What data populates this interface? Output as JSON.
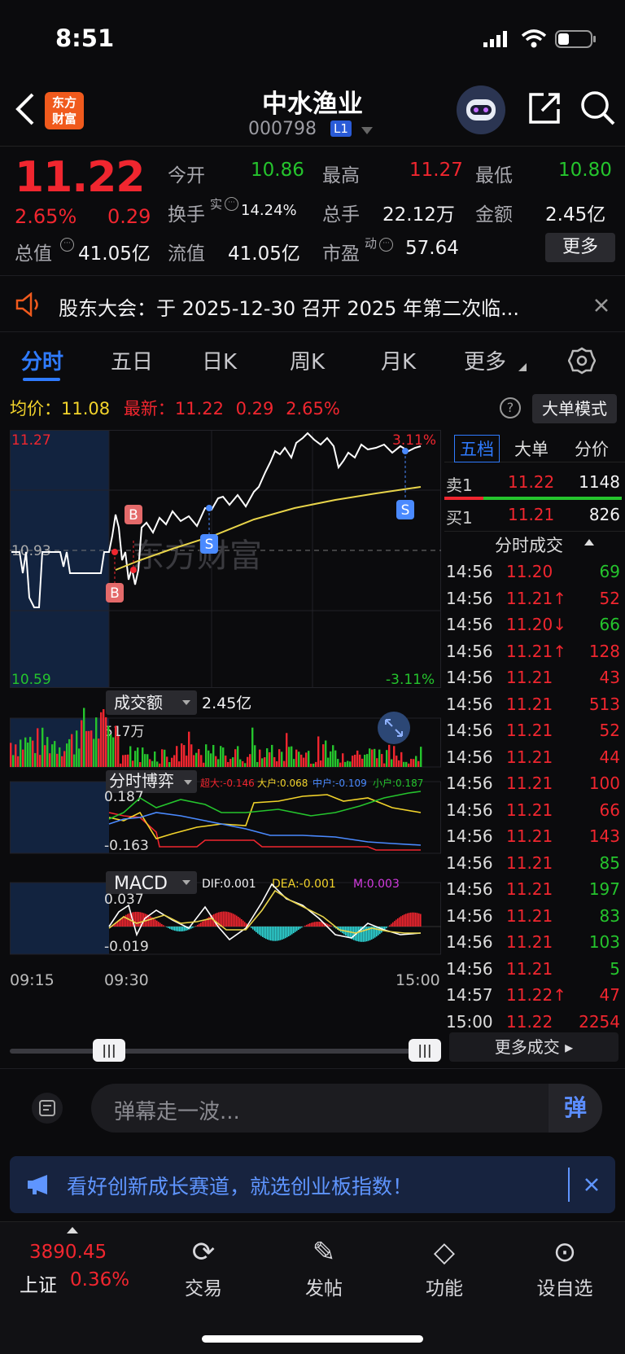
{
  "status": {
    "time": "8:51"
  },
  "header": {
    "logo_text_1": "东方",
    "logo_text_2": "财富",
    "stock_name": "中水渔业",
    "stock_code": "000798",
    "level": "L1"
  },
  "quote": {
    "last": "11.22",
    "change_pct": "2.65%",
    "change": "0.29",
    "open_label": "今开",
    "open": "10.86",
    "high_label": "最高",
    "high": "11.27",
    "low_label": "最低",
    "low": "10.80",
    "turnover_label": "换手",
    "turnover_sup": "实",
    "turnover": "14.24%",
    "volume_label": "总手",
    "volume": "22.12万",
    "amount_label": "金额",
    "amount": "2.45亿",
    "mktcap_label": "总值",
    "mktcap": "41.05亿",
    "float_label": "流值",
    "float": "41.05亿",
    "pe_label": "市盈",
    "pe_sup": "动",
    "pe": "57.64",
    "more_label": "更多"
  },
  "notice": {
    "text": "股东大会：于 2025-12-30 召开 2025 年第二次临..."
  },
  "tabs": [
    "分时",
    "五日",
    "日K",
    "周K",
    "月K",
    "更多"
  ],
  "info": {
    "avg_label": "均价：",
    "avg": "11.08",
    "latest_label": "最新：",
    "latest": "11.22",
    "chg": "0.29",
    "pct": "2.65%",
    "mode_btn": "大单模式"
  },
  "chart": {
    "price_top": "11.27",
    "price_bottom": "10.59",
    "price_mid": "10.93",
    "pct_top": "3.11%",
    "pct_bottom": "-3.11%",
    "watermark": "东方财富",
    "buy_marker": "B",
    "sell_marker": "S",
    "volume_title": "成交额",
    "volume_total": "2.45亿",
    "volume_max": "517万",
    "game_title": "分时博弈",
    "game_super": "超大:-0.146",
    "game_big": "大户:0.068",
    "game_mid": "中户:-0.109",
    "game_small": "小户:0.187",
    "game_top": "0.187",
    "game_bottom": "-0.163",
    "macd_title": "MACD",
    "dif": "DIF:0.001",
    "dea": "DEA:-0.001",
    "m": "M:0.003",
    "macd_top": "0.037",
    "macd_bottom": "-0.019",
    "time_start": "09:15",
    "time_open": "09:30",
    "time_end": "15:00",
    "colors": {
      "up": "#f0262f",
      "down": "#25c42d",
      "avg": "#e8d44a",
      "price": "#ffffff"
    }
  },
  "book": {
    "tabs": [
      "五档",
      "大单",
      "分价"
    ],
    "sell1_label": "卖1",
    "sell1_price": "11.22",
    "sell1_vol": "1148",
    "buy1_label": "买1",
    "buy1_price": "11.21",
    "buy1_vol": "826",
    "ticks_title": "分时成交",
    "ticks": [
      {
        "t": "14:56",
        "p": "11.20",
        "v": "69",
        "pc": "red",
        "vc": "green"
      },
      {
        "t": "14:56",
        "p": "11.21↑",
        "v": "52",
        "pc": "red",
        "vc": "red"
      },
      {
        "t": "14:56",
        "p": "11.20↓",
        "v": "66",
        "pc": "red",
        "vc": "green"
      },
      {
        "t": "14:56",
        "p": "11.21↑",
        "v": "128",
        "pc": "red",
        "vc": "red"
      },
      {
        "t": "14:56",
        "p": "11.21",
        "v": "43",
        "pc": "red",
        "vc": "red"
      },
      {
        "t": "14:56",
        "p": "11.21",
        "v": "513",
        "pc": "red",
        "vc": "red"
      },
      {
        "t": "14:56",
        "p": "11.21",
        "v": "52",
        "pc": "red",
        "vc": "red"
      },
      {
        "t": "14:56",
        "p": "11.21",
        "v": "44",
        "pc": "red",
        "vc": "red"
      },
      {
        "t": "14:56",
        "p": "11.21",
        "v": "100",
        "pc": "red",
        "vc": "red"
      },
      {
        "t": "14:56",
        "p": "11.21",
        "v": "66",
        "pc": "red",
        "vc": "red"
      },
      {
        "t": "14:56",
        "p": "11.21",
        "v": "143",
        "pc": "red",
        "vc": "red"
      },
      {
        "t": "14:56",
        "p": "11.21",
        "v": "85",
        "pc": "red",
        "vc": "green"
      },
      {
        "t": "14:56",
        "p": "11.21",
        "v": "197",
        "pc": "red",
        "vc": "green"
      },
      {
        "t": "14:56",
        "p": "11.21",
        "v": "83",
        "pc": "red",
        "vc": "green"
      },
      {
        "t": "14:56",
        "p": "11.21",
        "v": "103",
        "pc": "red",
        "vc": "green"
      },
      {
        "t": "14:56",
        "p": "11.21",
        "v": "5",
        "pc": "red",
        "vc": "green"
      },
      {
        "t": "14:57",
        "p": "11.22↑",
        "v": "47",
        "pc": "red",
        "vc": "red"
      },
      {
        "t": "15:00",
        "p": "11.22",
        "v": "2254",
        "pc": "red",
        "vc": "red"
      }
    ],
    "more_trades": "更多成交"
  },
  "comment": {
    "placeholder": "弹幕走一波...",
    "danmu_btn": "弹"
  },
  "ad": {
    "text": "看好创新成长赛道，就选创业板指数！"
  },
  "nav": {
    "index_value": "3890.45",
    "index_name": "上证",
    "index_pct": "0.36%",
    "items": [
      "交易",
      "发帖",
      "功能",
      "设自选"
    ]
  },
  "icons": [
    "back-icon",
    "robot-avatar-icon",
    "share-icon",
    "search-icon",
    "speaker-icon",
    "close-icon",
    "settings-icon",
    "help-icon",
    "expand-icon",
    "megaphone-icon",
    "chat-icon",
    "trade-icon",
    "post-icon",
    "function-icon",
    "watchlist-icon"
  ]
}
